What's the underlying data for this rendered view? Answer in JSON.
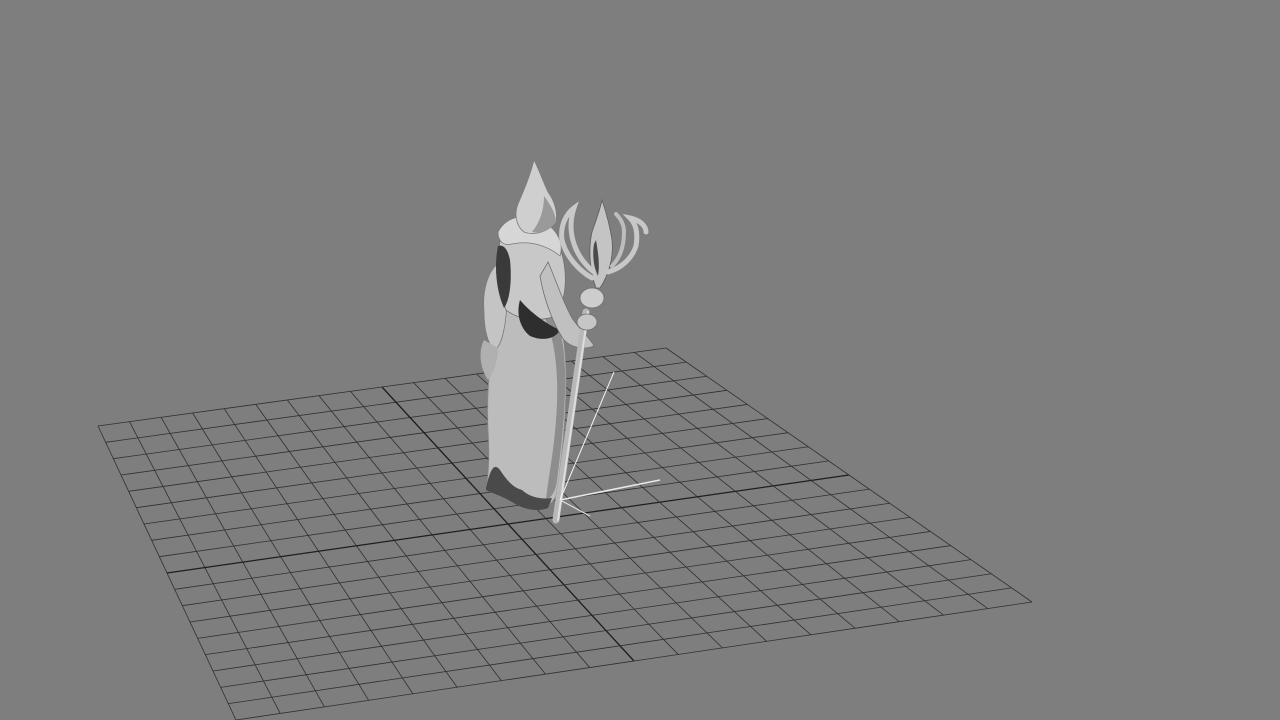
{
  "viewport": {
    "view_mode": "perspective",
    "shading": "smooth-shaded",
    "background_color": "#7e7e7e",
    "grid": {
      "visible": true,
      "divisions": 18,
      "line_color": "#303030",
      "axis_color": "#1e1e1e"
    },
    "model": {
      "name_icon": "robed-figure-with-staff",
      "base_color": "#bdbdbd",
      "shadow_color": "#2c2c2c",
      "highlight_color": "#e6e6e6"
    },
    "selection_axis_color": "#e8e8e8"
  }
}
